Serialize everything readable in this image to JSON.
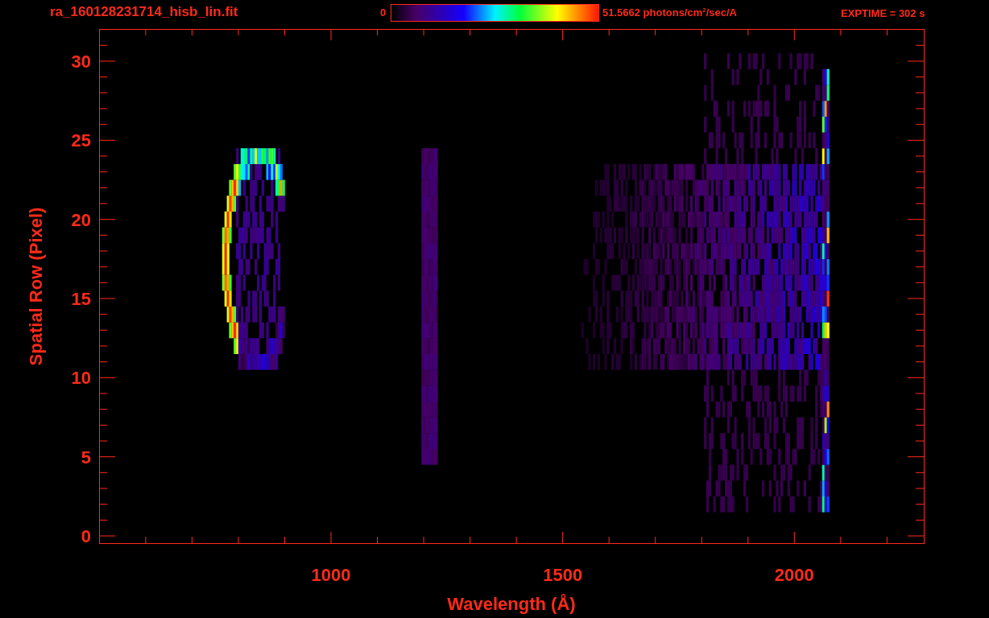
{
  "header": {
    "filename": "ra_160128231714_hisb_lin.fit",
    "colorbar": {
      "min_label": "0",
      "max_label": "51.5662 photons/cm$^{2}$/sec/A"
    },
    "exptime": "EXPTIME = 302 s"
  },
  "plot": {
    "xlabel": "Wavelength (Å)",
    "ylabel": "Spatial Row (Pixel)",
    "xtick_labels": [
      "1000",
      "1500",
      "2000"
    ],
    "ytick_labels": [
      "30",
      "25",
      "20",
      "15",
      "10",
      "5",
      "0"
    ]
  }
}
